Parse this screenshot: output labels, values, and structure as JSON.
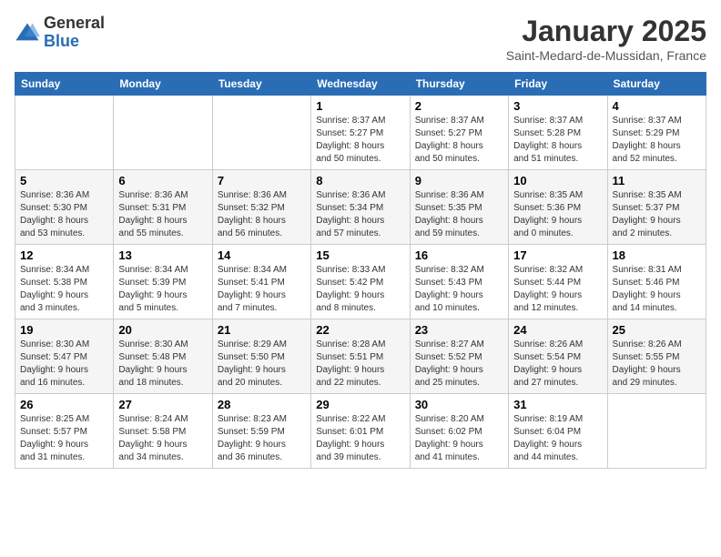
{
  "logo": {
    "general": "General",
    "blue": "Blue"
  },
  "title": "January 2025",
  "location": "Saint-Medard-de-Mussidan, France",
  "days_of_week": [
    "Sunday",
    "Monday",
    "Tuesday",
    "Wednesday",
    "Thursday",
    "Friday",
    "Saturday"
  ],
  "weeks": [
    [
      {
        "day": "",
        "info": ""
      },
      {
        "day": "",
        "info": ""
      },
      {
        "day": "",
        "info": ""
      },
      {
        "day": "1",
        "info": "Sunrise: 8:37 AM\nSunset: 5:27 PM\nDaylight: 8 hours\nand 50 minutes."
      },
      {
        "day": "2",
        "info": "Sunrise: 8:37 AM\nSunset: 5:27 PM\nDaylight: 8 hours\nand 50 minutes."
      },
      {
        "day": "3",
        "info": "Sunrise: 8:37 AM\nSunset: 5:28 PM\nDaylight: 8 hours\nand 51 minutes."
      },
      {
        "day": "4",
        "info": "Sunrise: 8:37 AM\nSunset: 5:29 PM\nDaylight: 8 hours\nand 52 minutes."
      }
    ],
    [
      {
        "day": "5",
        "info": "Sunrise: 8:36 AM\nSunset: 5:30 PM\nDaylight: 8 hours\nand 53 minutes."
      },
      {
        "day": "6",
        "info": "Sunrise: 8:36 AM\nSunset: 5:31 PM\nDaylight: 8 hours\nand 55 minutes."
      },
      {
        "day": "7",
        "info": "Sunrise: 8:36 AM\nSunset: 5:32 PM\nDaylight: 8 hours\nand 56 minutes."
      },
      {
        "day": "8",
        "info": "Sunrise: 8:36 AM\nSunset: 5:34 PM\nDaylight: 8 hours\nand 57 minutes."
      },
      {
        "day": "9",
        "info": "Sunrise: 8:36 AM\nSunset: 5:35 PM\nDaylight: 8 hours\nand 59 minutes."
      },
      {
        "day": "10",
        "info": "Sunrise: 8:35 AM\nSunset: 5:36 PM\nDaylight: 9 hours\nand 0 minutes."
      },
      {
        "day": "11",
        "info": "Sunrise: 8:35 AM\nSunset: 5:37 PM\nDaylight: 9 hours\nand 2 minutes."
      }
    ],
    [
      {
        "day": "12",
        "info": "Sunrise: 8:34 AM\nSunset: 5:38 PM\nDaylight: 9 hours\nand 3 minutes."
      },
      {
        "day": "13",
        "info": "Sunrise: 8:34 AM\nSunset: 5:39 PM\nDaylight: 9 hours\nand 5 minutes."
      },
      {
        "day": "14",
        "info": "Sunrise: 8:34 AM\nSunset: 5:41 PM\nDaylight: 9 hours\nand 7 minutes."
      },
      {
        "day": "15",
        "info": "Sunrise: 8:33 AM\nSunset: 5:42 PM\nDaylight: 9 hours\nand 8 minutes."
      },
      {
        "day": "16",
        "info": "Sunrise: 8:32 AM\nSunset: 5:43 PM\nDaylight: 9 hours\nand 10 minutes."
      },
      {
        "day": "17",
        "info": "Sunrise: 8:32 AM\nSunset: 5:44 PM\nDaylight: 9 hours\nand 12 minutes."
      },
      {
        "day": "18",
        "info": "Sunrise: 8:31 AM\nSunset: 5:46 PM\nDaylight: 9 hours\nand 14 minutes."
      }
    ],
    [
      {
        "day": "19",
        "info": "Sunrise: 8:30 AM\nSunset: 5:47 PM\nDaylight: 9 hours\nand 16 minutes."
      },
      {
        "day": "20",
        "info": "Sunrise: 8:30 AM\nSunset: 5:48 PM\nDaylight: 9 hours\nand 18 minutes."
      },
      {
        "day": "21",
        "info": "Sunrise: 8:29 AM\nSunset: 5:50 PM\nDaylight: 9 hours\nand 20 minutes."
      },
      {
        "day": "22",
        "info": "Sunrise: 8:28 AM\nSunset: 5:51 PM\nDaylight: 9 hours\nand 22 minutes."
      },
      {
        "day": "23",
        "info": "Sunrise: 8:27 AM\nSunset: 5:52 PM\nDaylight: 9 hours\nand 25 minutes."
      },
      {
        "day": "24",
        "info": "Sunrise: 8:26 AM\nSunset: 5:54 PM\nDaylight: 9 hours\nand 27 minutes."
      },
      {
        "day": "25",
        "info": "Sunrise: 8:26 AM\nSunset: 5:55 PM\nDaylight: 9 hours\nand 29 minutes."
      }
    ],
    [
      {
        "day": "26",
        "info": "Sunrise: 8:25 AM\nSunset: 5:57 PM\nDaylight: 9 hours\nand 31 minutes."
      },
      {
        "day": "27",
        "info": "Sunrise: 8:24 AM\nSunset: 5:58 PM\nDaylight: 9 hours\nand 34 minutes."
      },
      {
        "day": "28",
        "info": "Sunrise: 8:23 AM\nSunset: 5:59 PM\nDaylight: 9 hours\nand 36 minutes."
      },
      {
        "day": "29",
        "info": "Sunrise: 8:22 AM\nSunset: 6:01 PM\nDaylight: 9 hours\nand 39 minutes."
      },
      {
        "day": "30",
        "info": "Sunrise: 8:20 AM\nSunset: 6:02 PM\nDaylight: 9 hours\nand 41 minutes."
      },
      {
        "day": "31",
        "info": "Sunrise: 8:19 AM\nSunset: 6:04 PM\nDaylight: 9 hours\nand 44 minutes."
      },
      {
        "day": "",
        "info": ""
      }
    ]
  ]
}
